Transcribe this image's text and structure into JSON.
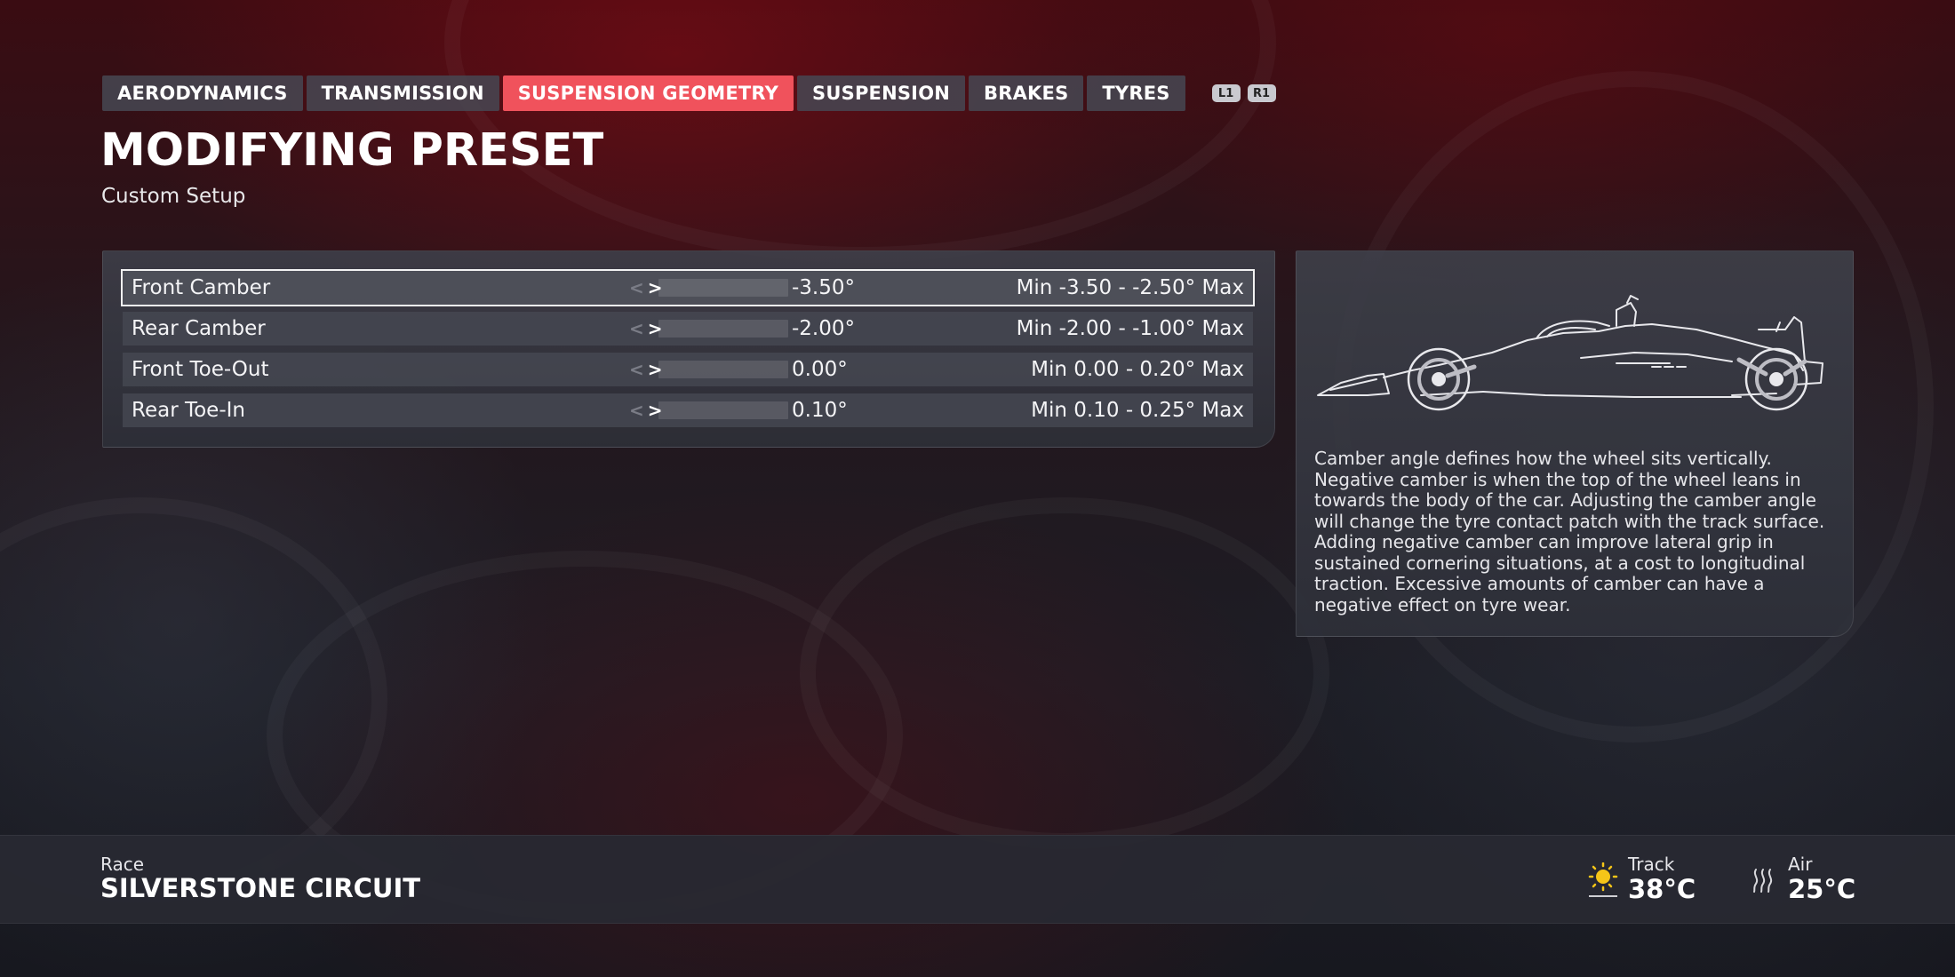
{
  "tabs": [
    {
      "label": "AERODYNAMICS",
      "active": false
    },
    {
      "label": "TRANSMISSION",
      "active": false
    },
    {
      "label": "SUSPENSION GEOMETRY",
      "active": true
    },
    {
      "label": "SUSPENSION",
      "active": false
    },
    {
      "label": "BRAKES",
      "active": false
    },
    {
      "label": "TYRES",
      "active": false
    }
  ],
  "shoulder_buttons": {
    "left": "L1",
    "right": "R1"
  },
  "header": {
    "title": "MODIFYING PRESET",
    "subtitle": "Custom Setup"
  },
  "settings": [
    {
      "label": "Front Camber",
      "value": "-3.50°",
      "range": "Min -3.50 - -2.50° Max",
      "fill_fraction": 0.0,
      "selected": true
    },
    {
      "label": "Rear Camber",
      "value": "-2.00°",
      "range": "Min -2.00 - -1.00° Max",
      "fill_fraction": 0.0,
      "selected": false
    },
    {
      "label": "Front Toe-Out",
      "value": "0.00°",
      "range": "Min 0.00 - 0.20° Max",
      "fill_fraction": 0.0,
      "selected": false
    },
    {
      "label": "Rear Toe-In",
      "value": "0.10°",
      "range": "Min 0.10 - 0.25° Max",
      "fill_fraction": 0.0,
      "selected": false
    }
  ],
  "info": {
    "description": "Camber angle defines how the wheel sits vertically. Negative camber is when the top of the wheel leans in towards the body of the car. Adjusting the camber angle will change the tyre contact patch with the track surface. Adding negative camber can improve lateral grip in sustained cornering situations, at a cost to longitudinal traction. Excessive amounts of camber can have a negative effect on tyre wear."
  },
  "footer": {
    "session_label": "Race",
    "circuit": "SILVERSTONE CIRCUIT",
    "track": {
      "label": "Track",
      "value": "38°C",
      "icon": "sun-icon"
    },
    "air": {
      "label": "Air",
      "value": "25°C",
      "icon": "heat-waves-icon"
    }
  },
  "colors": {
    "accent": "#f0525c",
    "panel": "#3e404a",
    "text": "#ffffff"
  }
}
